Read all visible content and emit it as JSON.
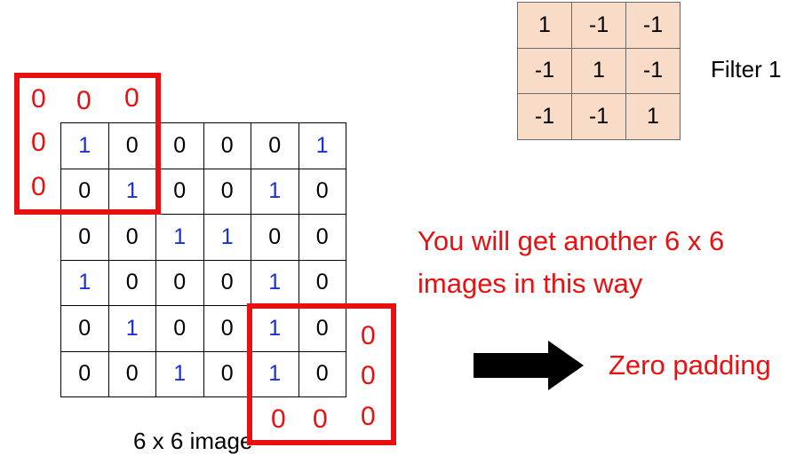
{
  "image": {
    "rows": [
      [
        "1",
        "0",
        "0",
        "0",
        "0",
        "1"
      ],
      [
        "0",
        "1",
        "0",
        "0",
        "1",
        "0"
      ],
      [
        "0",
        "0",
        "1",
        "1",
        "0",
        "0"
      ],
      [
        "1",
        "0",
        "0",
        "0",
        "1",
        "0"
      ],
      [
        "0",
        "1",
        "0",
        "0",
        "1",
        "0"
      ],
      [
        "0",
        "0",
        "1",
        "0",
        "1",
        "0"
      ]
    ],
    "caption": "6 x 6 image"
  },
  "filter": {
    "rows": [
      [
        "1",
        "-1",
        "-1"
      ],
      [
        "-1",
        "1",
        "-1"
      ],
      [
        "-1",
        "-1",
        "1"
      ]
    ],
    "label": "Filter 1"
  },
  "padding": {
    "zero": "0"
  },
  "message": "You will get another 6 x 6 images in this way",
  "zero_padding_label": "Zero padding",
  "colors": {
    "one_digit": "#1a2fd6",
    "zero_digit": "#000000",
    "accent_red": "#e81010",
    "filter_fill": "#f9dcc8"
  }
}
